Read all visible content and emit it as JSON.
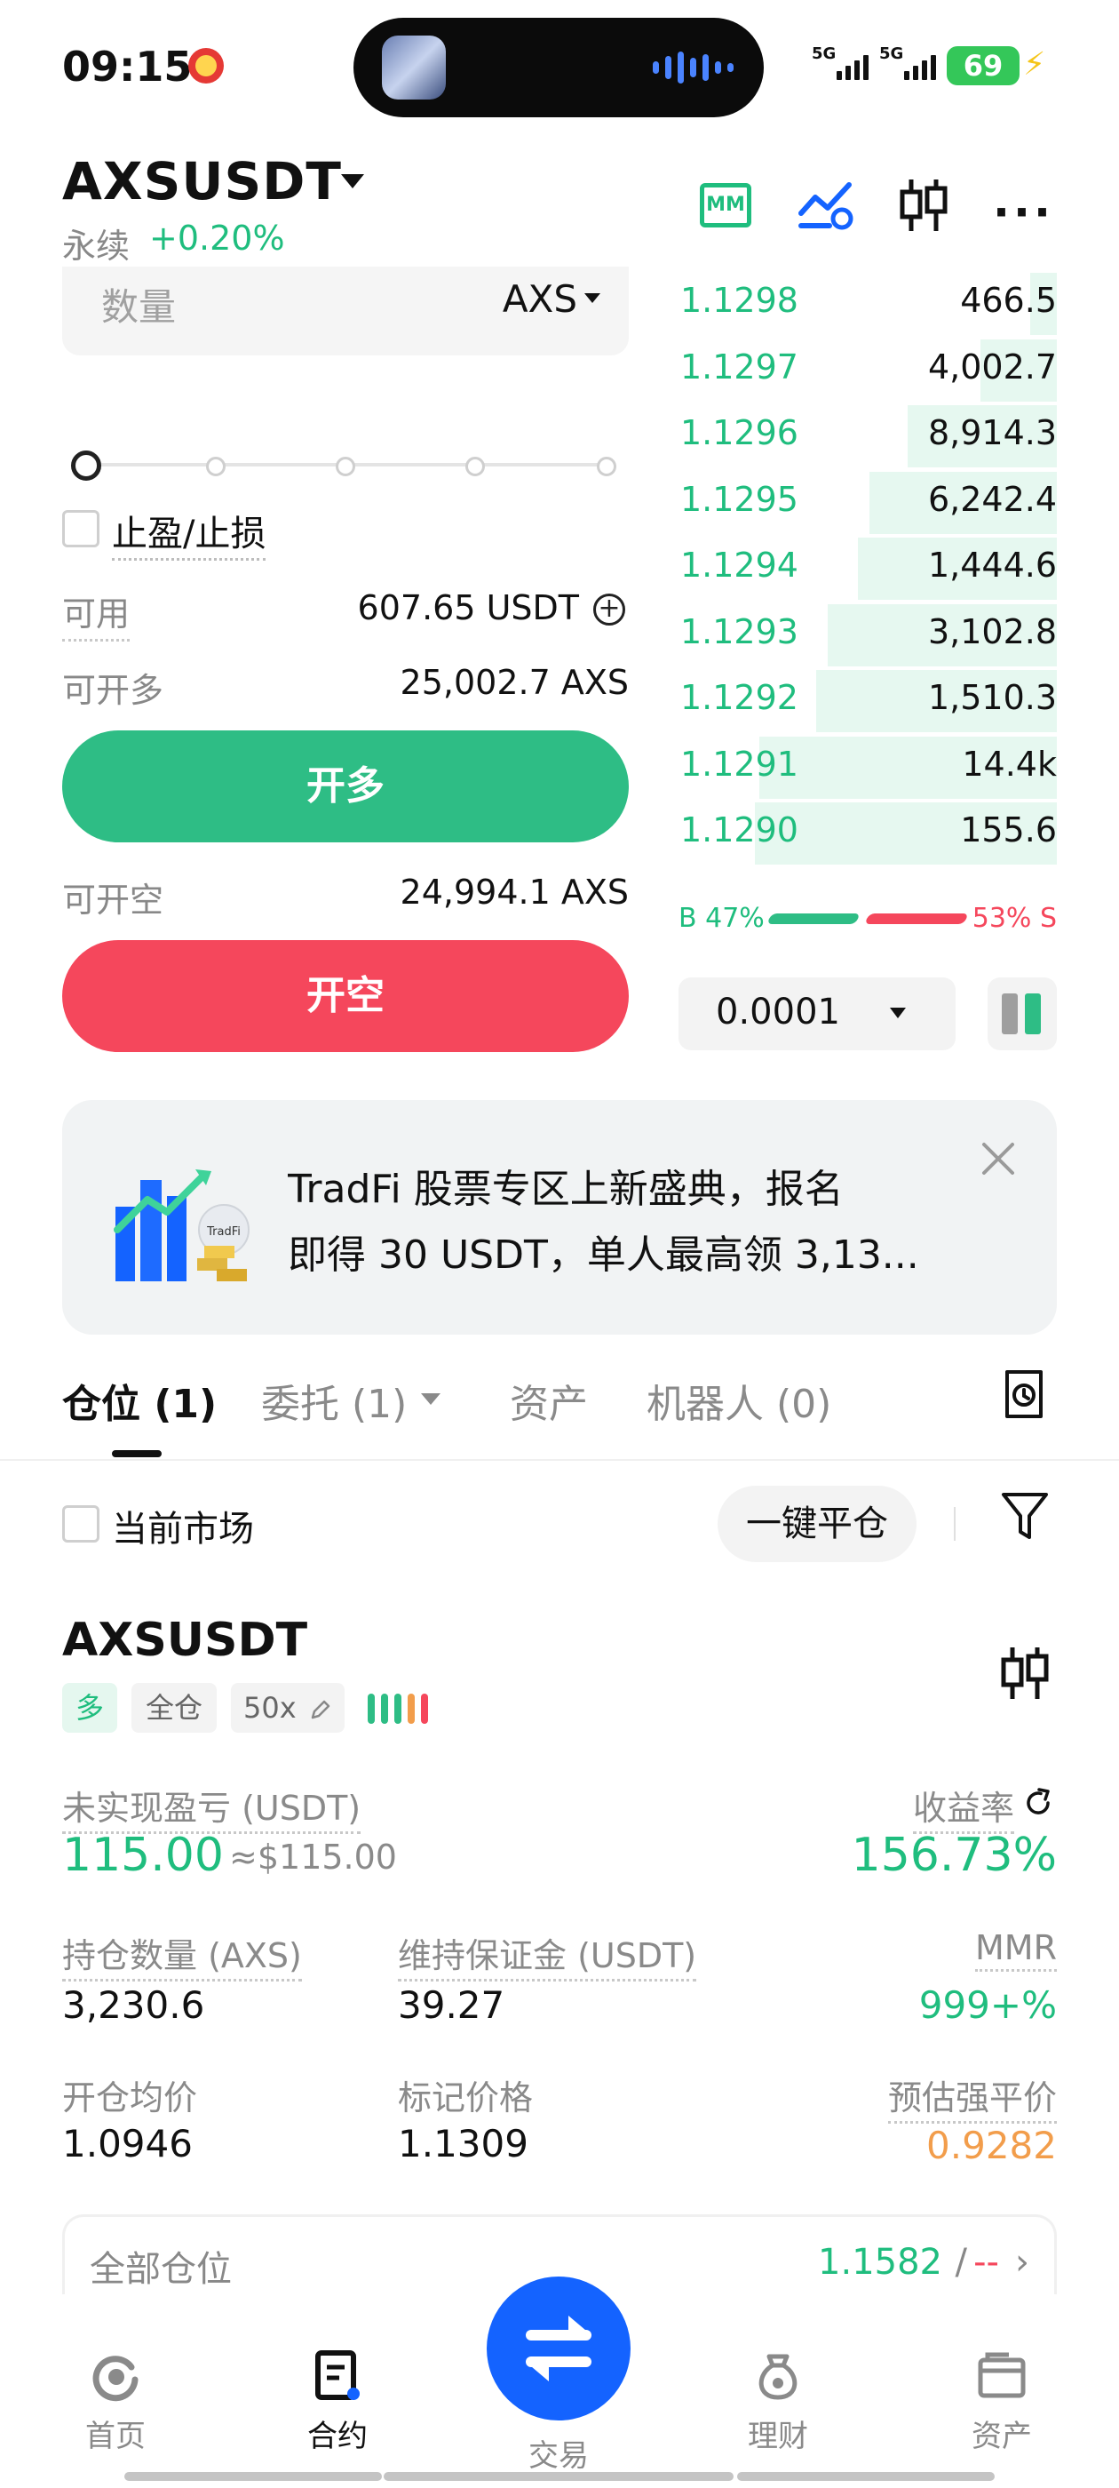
{
  "status_bar": {
    "time": "09:15",
    "net1": "5G",
    "net2": "5G",
    "battery": "69"
  },
  "header": {
    "symbol": "AXSUSDT",
    "contract_type": "永续",
    "change": "+0.20%",
    "mm_label": "MM"
  },
  "order_form": {
    "quantity_label": "数量",
    "quantity_unit": "AXS",
    "tpsl_label": "止盈/止损",
    "available_label": "可用",
    "available_value": "607.65 USDT",
    "max_long_label": "可开多",
    "max_long_value": "25,002.7 AXS",
    "long_button": "开多",
    "max_short_label": "可开空",
    "max_short_value": "24,994.1 AXS",
    "short_button": "开空"
  },
  "order_book": {
    "bids": [
      {
        "price": "1.1298",
        "size": "466.5",
        "depth": 0.07
      },
      {
        "price": "1.1297",
        "size": "4,002.7",
        "depth": 0.2
      },
      {
        "price": "1.1296",
        "size": "8,914.3",
        "depth": 0.39
      },
      {
        "price": "1.1295",
        "size": "6,242.4",
        "depth": 0.49
      },
      {
        "price": "1.1294",
        "size": "1,444.6",
        "depth": 0.52
      },
      {
        "price": "1.1293",
        "size": "3,102.8",
        "depth": 0.6
      },
      {
        "price": "1.1292",
        "size": "1,510.3",
        "depth": 0.63
      },
      {
        "price": "1.1291",
        "size": "14.4k",
        "depth": 0.78
      },
      {
        "price": "1.1290",
        "size": "155.6",
        "depth": 0.79
      }
    ],
    "buy_ratio": "B 47%",
    "sell_ratio": "53% S",
    "precision": "0.0001"
  },
  "banner": {
    "line1": "TradFi 股票专区上新盛典，报名",
    "line2": "即得 30 USDT，单人最高领 3,13...",
    "art_label": "TradFi"
  },
  "tabs": {
    "positions": "仓位 (1)",
    "orders": "委托 (1)",
    "assets": "资产",
    "bots": "机器人 (0)"
  },
  "filters": {
    "current_market": "当前市场",
    "close_all": "一键平仓"
  },
  "position": {
    "symbol": "AXSUSDT",
    "side": "多",
    "margin_mode": "全仓",
    "leverage": "50x",
    "unrealized_pnl_label": "未实现盈亏 (USDT)",
    "unrealized_pnl": "115.00",
    "unrealized_pnl_usd": "≈$115.00",
    "roe_label": "收益率",
    "roe": "156.73%",
    "size_label": "持仓数量 (AXS)",
    "size": "3,230.6",
    "maint_margin_label": "维持保证金 (USDT)",
    "maint_margin": "39.27",
    "mmr_label": "MMR",
    "mmr": "999+%",
    "entry_label": "开仓均价",
    "entry": "1.0946",
    "mark_label": "标记价格",
    "mark": "1.1309",
    "liq_label": "预估强平价",
    "liq": "0.9282"
  },
  "all_positions": {
    "label": "全部仓位",
    "value": "1.1582",
    "sep": "/",
    "dash": "--"
  },
  "bottom_nav": {
    "home": "首页",
    "futures": "合约",
    "trade": "交易",
    "earn": "理财",
    "assets": "资产"
  },
  "colors": {
    "green": "#2ebd85",
    "red": "#f5475c",
    "orange": "#f29d4b",
    "blue": "#1463ff"
  }
}
